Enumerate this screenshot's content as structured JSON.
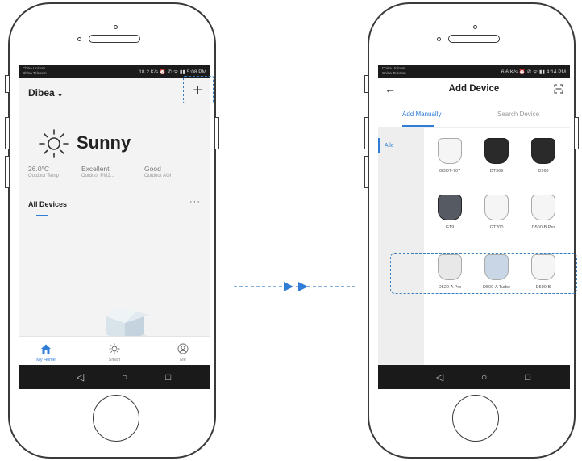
{
  "left_phone": {
    "status_bar": {
      "carrier_line1": "China Unicom",
      "carrier_line2": "China Telecom",
      "right": "18.2 K/s ⏰ ✆ ᯤ ▮▮ 5:08 PM"
    },
    "home": {
      "title": "Dibea",
      "add_button": "+"
    },
    "weather": {
      "condition": "Sunny",
      "icon": "sun-icon"
    },
    "stats": [
      {
        "value": "26.0°C",
        "label": "Outdoor Temp"
      },
      {
        "value": "Excellent",
        "label": "Outdoor PM2..."
      },
      {
        "value": "Good",
        "label": "Outdoor AQI"
      }
    ],
    "devices": {
      "title": "All Devices",
      "more": "···"
    },
    "tabs": [
      {
        "label": "My Home",
        "icon": "home-icon",
        "active": true
      },
      {
        "label": "Smart",
        "icon": "sun-outline-icon",
        "active": false
      },
      {
        "label": "Me",
        "icon": "user-icon",
        "active": false
      }
    ],
    "navbar": {
      "back": "◁",
      "home": "○",
      "recent": "□"
    }
  },
  "right_phone": {
    "status_bar": {
      "carrier_line1": "China Unicom",
      "carrier_line2": "China Telecom",
      "right": "6.6 K/s ⏰ ✆ ᯤ ▮▮ 4:14 PM"
    },
    "header": {
      "back": "←",
      "title": "Add Device",
      "scan_icon": "scan-icon"
    },
    "tabs": {
      "manual": "Add Manually",
      "search": "Search Device"
    },
    "category": "Alle",
    "devices": [
      {
        "name": "GBOT-707",
        "color": "#f5f5f5"
      },
      {
        "name": "DT969",
        "color": "#2a2a2a"
      },
      {
        "name": "D960",
        "color": "#2a2a2a"
      },
      {
        "name": "GT9",
        "color": "#555a63"
      },
      {
        "name": "GT200",
        "color": "#f5f5f5"
      },
      {
        "name": "D500-B Pro",
        "color": "#f5f5f5"
      },
      {
        "name": "D520-A Pro",
        "color": "#e8e8e8"
      },
      {
        "name": "D500-A Turbo",
        "color": "#c9d6e6"
      },
      {
        "name": "D500-B",
        "color": "#f5f5f5"
      }
    ],
    "navbar": {
      "back": "◁",
      "home": "○",
      "recent": "□"
    }
  },
  "colors": {
    "accent": "#2f7dd6",
    "dash": "#3a7fc1"
  }
}
